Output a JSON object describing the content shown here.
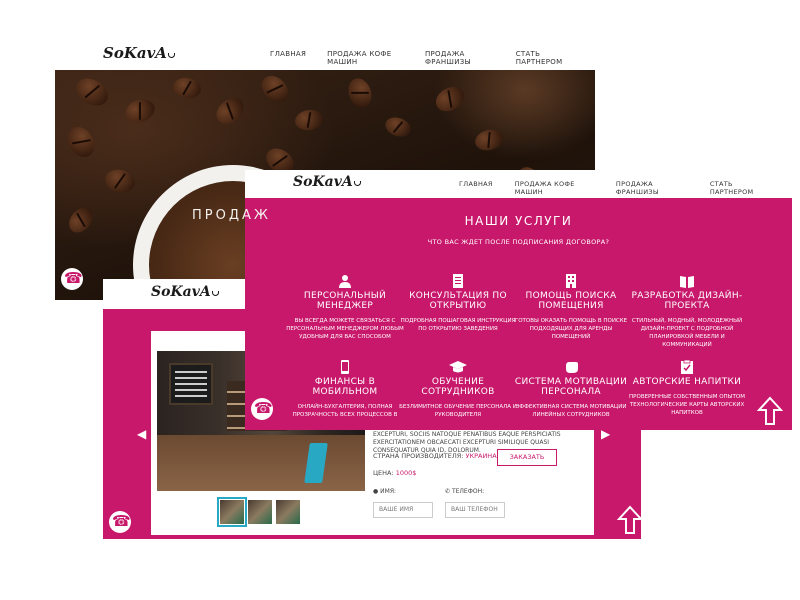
{
  "brand": {
    "logo_text": "SoKavA"
  },
  "nav": {
    "items": [
      "Главная",
      "Продажа кофе машин",
      "Продажа франшизы",
      "Стать партнером"
    ]
  },
  "hero": {
    "text": "ПРОДАЖ"
  },
  "services": {
    "title": "Наши услуги",
    "subtitle": "Что вас ждет после подписания договора?",
    "items": [
      {
        "icon": "person-icon",
        "name": "Персональный менеджер",
        "text": "Вы всегда можете связаться с персональным менеджером любым удобным для вас способом"
      },
      {
        "icon": "document-icon",
        "name": "Консультация по открытию",
        "text": "Подробная пошаговая инструкция по открытию заведения"
      },
      {
        "icon": "building-icon",
        "name": "Помощь поиска помещения",
        "text": "Готовы оказать помощь в поиске подходящих для аренды помещений"
      },
      {
        "icon": "book-icon",
        "name": "Разработка дизайн-проекта",
        "text": "Стильный, модный, молодежный дизайн-проект с подробной планировкой мебели и коммуникаций"
      },
      {
        "icon": "mobile-icon",
        "name": "Финансы в мобильном",
        "text": "Онлайн-бухгалтерия, полная прозрачность всех процессов в"
      },
      {
        "icon": "graduation-cap-icon",
        "name": "Обучение сотрудников",
        "text": "Безлимитное обучение персонала и руководителя"
      },
      {
        "icon": "hand-icon",
        "name": "Система мотивации персонала",
        "text": "Эффективная система мотивации линейных сотрудников"
      },
      {
        "icon": "checklist-icon",
        "name": "Авторские напитки",
        "text": "Проверенные собственным опытом технологические карты авторских напитков"
      }
    ]
  },
  "product": {
    "description": "excepturi, sociis natoque penatibus eaque perspiciatis exercitationem obcaecati excepturi similique quasi consequatur quia id, dolorum.",
    "country_label": "Страна производителя:",
    "country_value": "Украина",
    "price_label": "Цена:",
    "price_value": "1000$",
    "name_label": "Имя:",
    "name_placeholder": "Ваше имя",
    "phone_label": "Телефон:",
    "phone_placeholder": "Ваш телефон",
    "order_button": "Заказать"
  },
  "colors": {
    "accent": "#c8186b",
    "white": "#ffffff",
    "slider_active": "#29a8c4"
  }
}
